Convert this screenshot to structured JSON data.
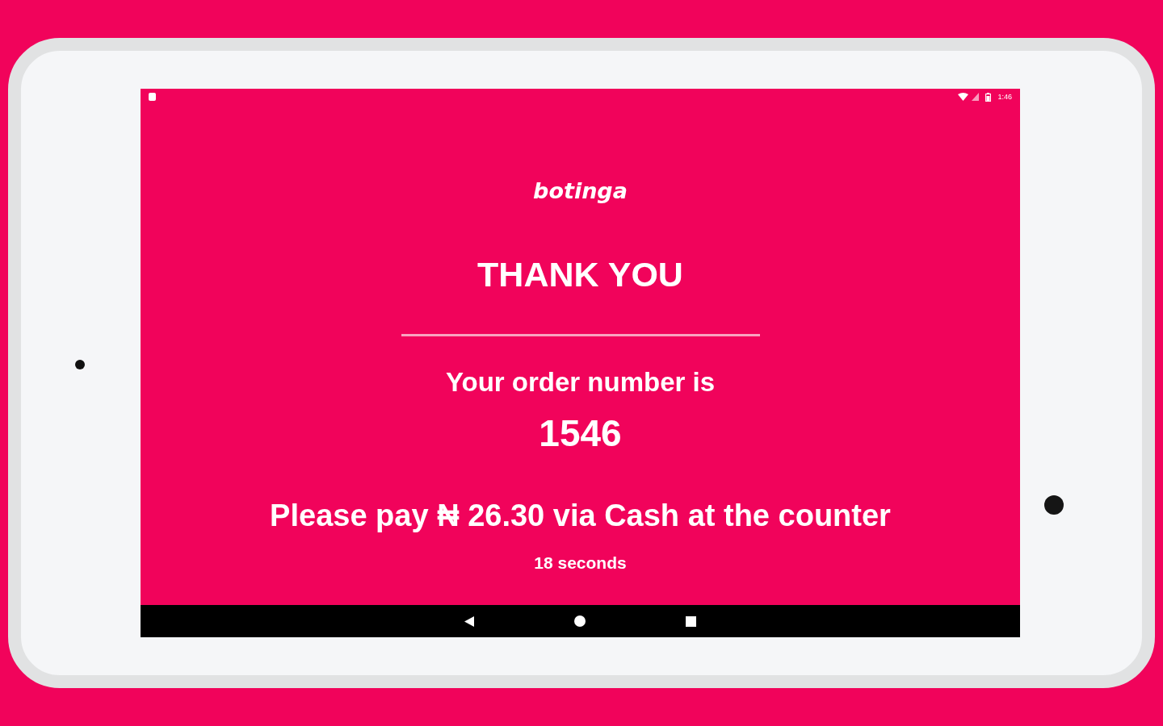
{
  "status_bar": {
    "time": "1:46"
  },
  "brand": {
    "logo": "botinga"
  },
  "heading": "THANK YOU",
  "order": {
    "label": "Your order number is",
    "number": "1546"
  },
  "payment_message": "Please pay ₦ 26.30 via Cash at the counter",
  "countdown": "18 seconds"
}
